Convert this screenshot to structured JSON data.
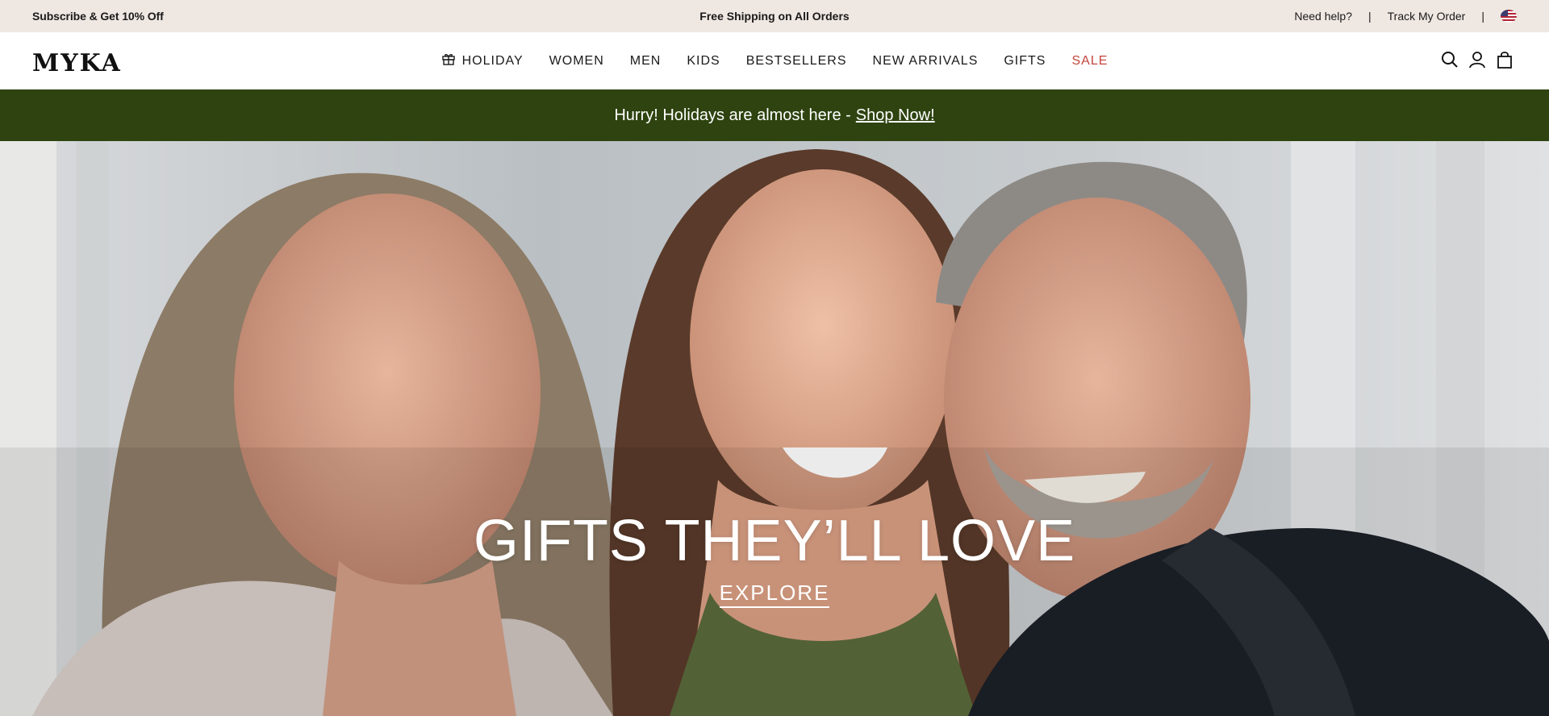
{
  "topbar": {
    "promo_left": "Subscribe & Get 10% Off",
    "promo_center": "Free Shipping on All Orders",
    "help_link": "Need help?",
    "separator": "|",
    "track_link": "Track My Order",
    "flag_icon": "us-flag-icon"
  },
  "header": {
    "logo": "MYKA",
    "nav": [
      {
        "label": "HOLIDAY",
        "icon": "gift-icon"
      },
      {
        "label": "WOMEN"
      },
      {
        "label": "MEN"
      },
      {
        "label": "KIDS"
      },
      {
        "label": "BESTSELLERS"
      },
      {
        "label": "NEW ARRIVALS"
      },
      {
        "label": "GIFTS"
      },
      {
        "label": "SALE",
        "color": "#c4453c"
      }
    ],
    "icons": [
      "search-icon",
      "account-icon",
      "bag-icon"
    ]
  },
  "announcement": {
    "text": "Hurry! Holidays are almost here -",
    "link": "Shop Now!",
    "background": "#2e4310"
  },
  "hero": {
    "title": "GIFTS THEY’LL LOVE",
    "cta": "EXPLORE"
  },
  "colors": {
    "topbar_bg": "#efe7e2",
    "accent_sale": "#c4453c",
    "announcement_bg": "#2e4310"
  }
}
